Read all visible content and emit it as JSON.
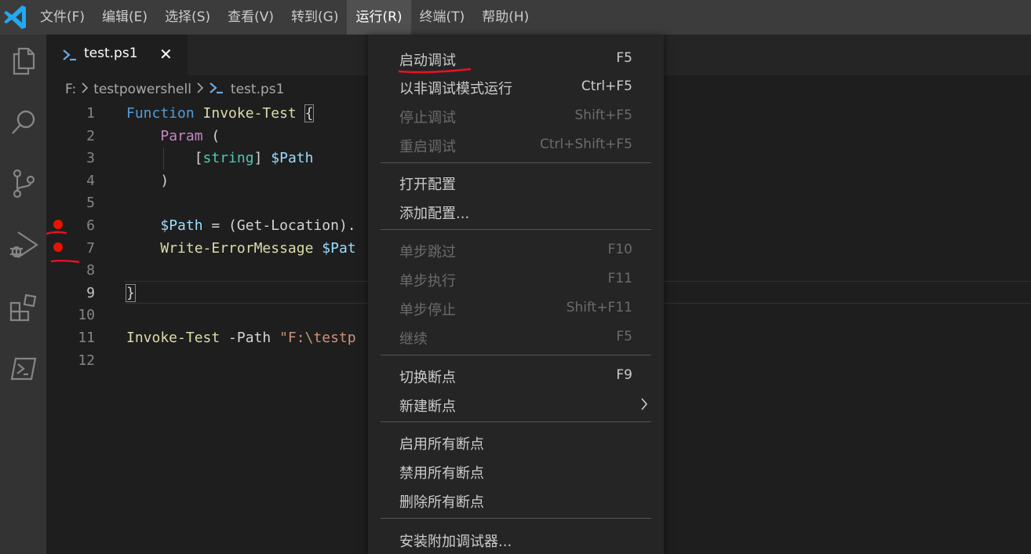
{
  "menubar": {
    "items": [
      {
        "label": "文件(F)"
      },
      {
        "label": "编辑(E)"
      },
      {
        "label": "选择(S)"
      },
      {
        "label": "查看(V)"
      },
      {
        "label": "转到(G)"
      },
      {
        "label": "运行(R)"
      },
      {
        "label": "终端(T)"
      },
      {
        "label": "帮助(H)"
      }
    ],
    "active_index": 5
  },
  "activity_bar": {
    "icons": [
      "explorer-icon",
      "search-icon",
      "source-control-icon",
      "run-debug-icon",
      "extensions-icon",
      "powershell-icon"
    ]
  },
  "tab": {
    "label": "test.ps1",
    "close": "✕"
  },
  "breadcrumb": {
    "drive": "F:",
    "folder": "testpowershell",
    "file": "test.ps1"
  },
  "editor": {
    "line_numbers": [
      "1",
      "2",
      "3",
      "4",
      "5",
      "6",
      "7",
      "8",
      "9",
      "10",
      "11",
      "12"
    ],
    "current_line": 9,
    "breakpoint_lines": [
      6,
      7
    ],
    "code": {
      "l1_kw": "Function",
      "l1_fn": "Invoke-Test",
      "l1_brace": "{",
      "l2_kw": "Param",
      "l2_paren": " (",
      "l3_open": "[",
      "l3_type": "string",
      "l3_close": "] ",
      "l3_var": "$Path",
      "l4": ")",
      "l6_var": "$Path",
      "l6_rest": " = (Get-Location).",
      "l7_fn": "Write-ErrorMessage",
      "l7_var": " $Pat",
      "l9_brace": "}",
      "l11_fn": "Invoke-Test",
      "l11_param": " -Path ",
      "l11_str": "\"F:\\testp"
    }
  },
  "run_menu": {
    "items": [
      {
        "label": "启动调试",
        "key": "F5",
        "enabled": true
      },
      {
        "label": "以非调试模式运行",
        "key": "Ctrl+F5",
        "enabled": true
      },
      {
        "label": "停止调试",
        "key": "Shift+F5",
        "enabled": false
      },
      {
        "label": "重启调试",
        "key": "Ctrl+Shift+F5",
        "enabled": false
      },
      {
        "label": "打开配置",
        "key": "",
        "enabled": true
      },
      {
        "label": "添加配置...",
        "key": "",
        "enabled": true
      },
      {
        "label": "单步跳过",
        "key": "F10",
        "enabled": false
      },
      {
        "label": "单步执行",
        "key": "F11",
        "enabled": false
      },
      {
        "label": "单步停止",
        "key": "Shift+F11",
        "enabled": false
      },
      {
        "label": "继续",
        "key": "F5",
        "enabled": false
      },
      {
        "label": "切换断点",
        "key": "F9",
        "enabled": true
      },
      {
        "label": "新建断点",
        "key": "",
        "enabled": true,
        "submenu": true
      },
      {
        "label": "启用所有断点",
        "key": "",
        "enabled": true
      },
      {
        "label": "禁用所有断点",
        "key": "",
        "enabled": true
      },
      {
        "label": "删除所有断点",
        "key": "",
        "enabled": true
      },
      {
        "label": "安装附加调试器...",
        "key": "",
        "enabled": true
      }
    ]
  },
  "colors": {
    "accent_blue": "#007acc",
    "breakpoint_red": "#e51400",
    "annotation_red": "#e81123"
  }
}
